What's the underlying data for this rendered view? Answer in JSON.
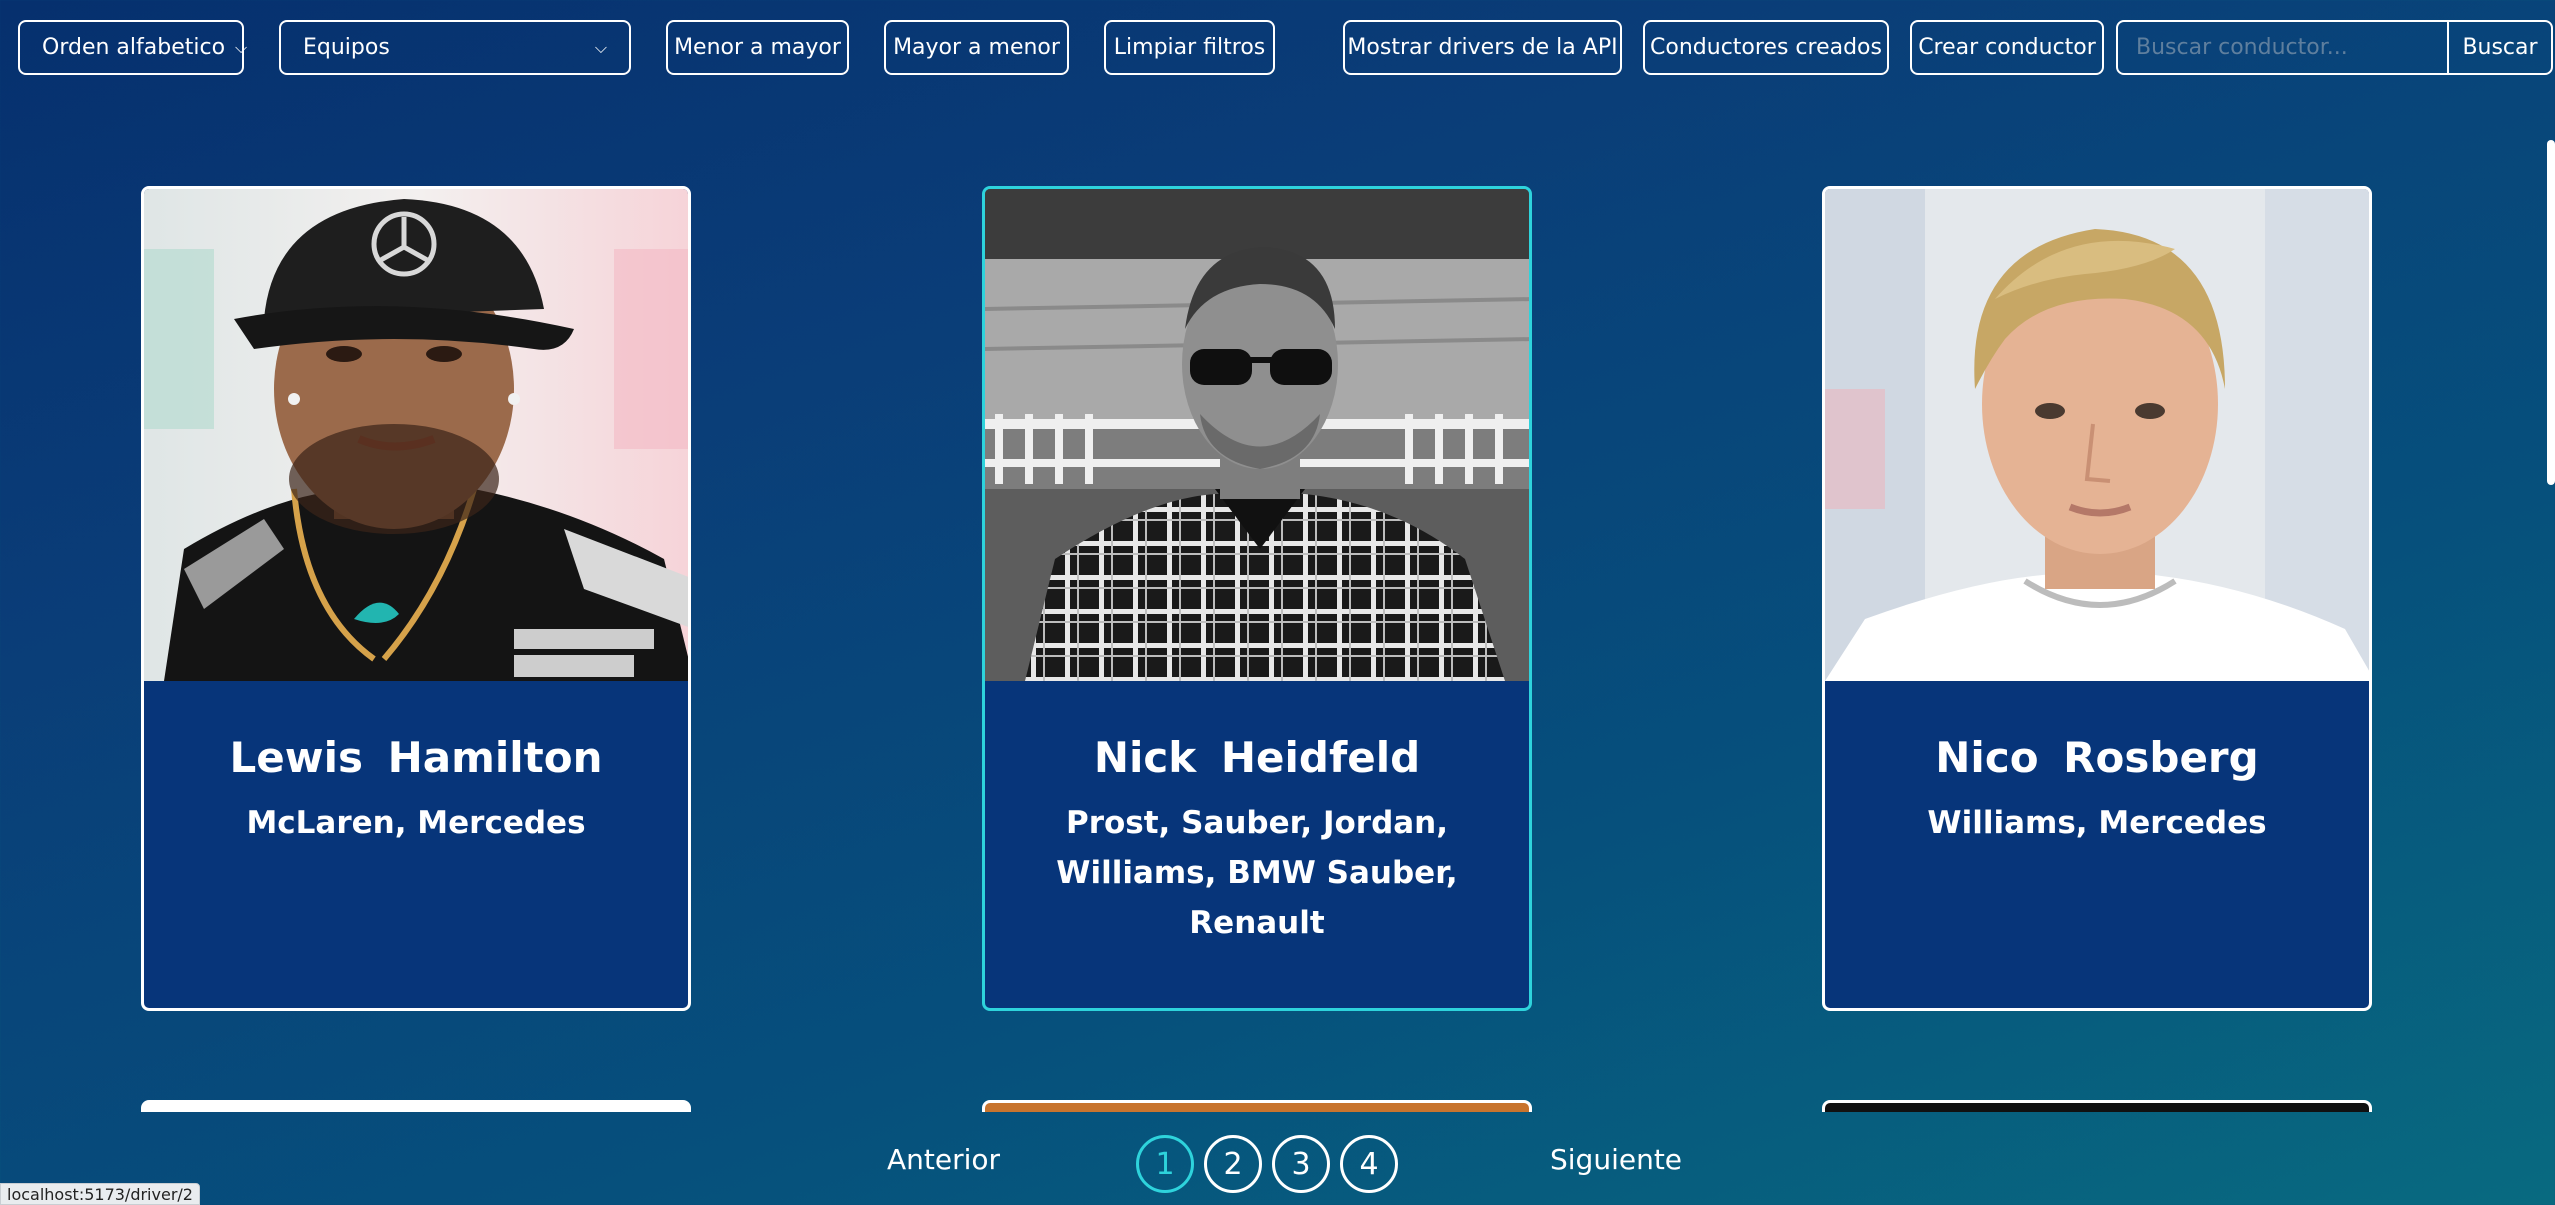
{
  "toolbar": {
    "sort_alpha": "Orden alfabetico",
    "teams_select": "Equipos",
    "asc": "Menor a mayor",
    "desc": "Mayor a menor",
    "clear": "Limpiar filtros",
    "api_drivers": "Mostrar drivers de la API",
    "created_drivers": "Conductores creados",
    "create_driver": "Crear conductor",
    "search_placeholder": "Buscar conductor...",
    "search_button": "Buscar"
  },
  "cards": [
    {
      "name": "Lewis  Hamilton",
      "teams": "McLaren, Mercedes"
    },
    {
      "name": "Nick  Heidfeld",
      "teams": "Prost, Sauber, Jordan, Williams, BMW Sauber, Renault"
    },
    {
      "name": "Nico  Rosberg",
      "teams": "Williams, Mercedes"
    }
  ],
  "pagination": {
    "prev": "Anterior",
    "next": "Siguiente",
    "pages": [
      "1",
      "2",
      "3",
      "4"
    ],
    "current": "1"
  },
  "status_bar": {
    "url": "localhost:5173/driver/2"
  },
  "colors": {
    "accent": "#2ed3dc",
    "border": "#ffffff"
  }
}
